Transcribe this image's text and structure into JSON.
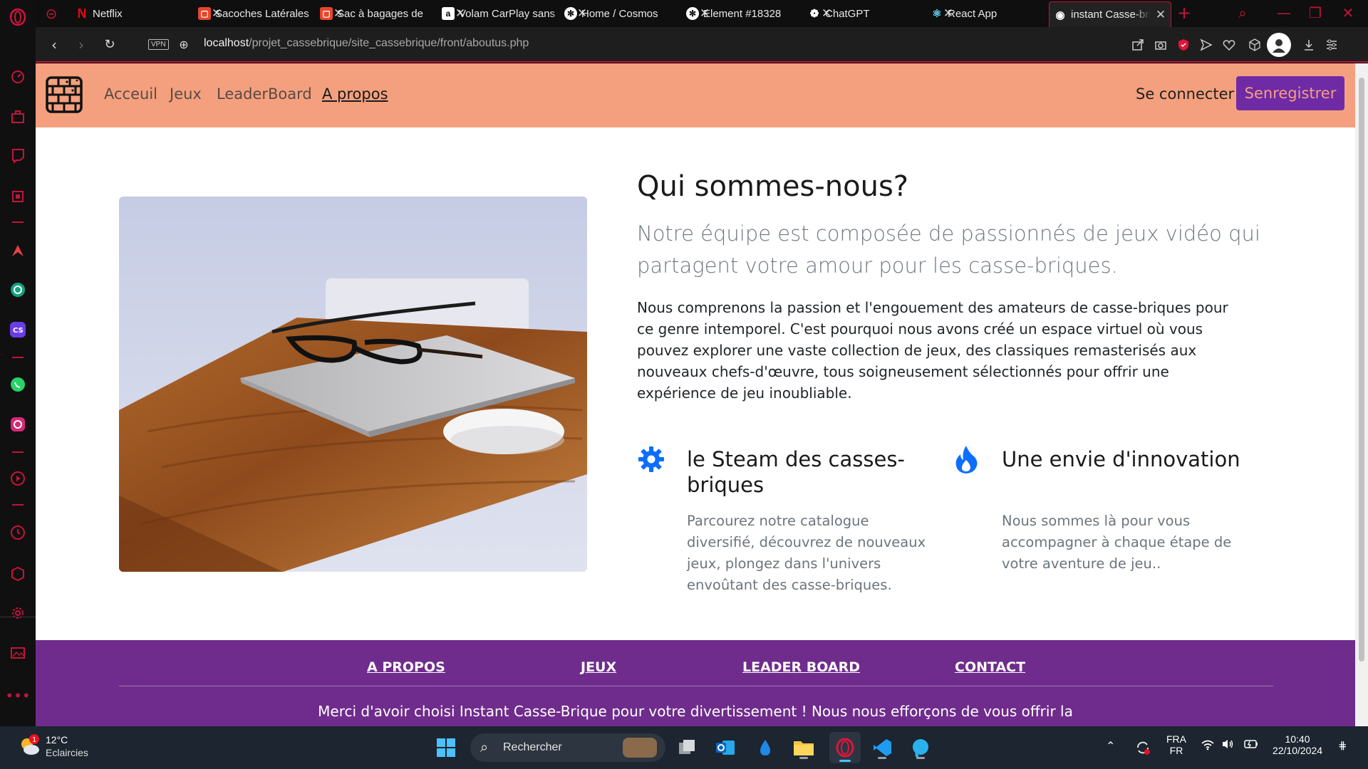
{
  "browser": {
    "tabs": [
      {
        "title": "Netflix",
        "favicon": "netflix-icon",
        "color": "#e50914"
      },
      {
        "title": "Sacoches Latérales",
        "favicon": "shop-icon",
        "color": "#e8462b"
      },
      {
        "title": "Sac à bagages de",
        "favicon": "shop-icon",
        "color": "#e8462b"
      },
      {
        "title": "Volam CarPlay sans",
        "favicon": "amazon-icon",
        "color": "#ffffff"
      },
      {
        "title": "Home / Cosmos",
        "favicon": "cosmos-icon",
        "color": "#ffffff"
      },
      {
        "title": "Element #18328",
        "favicon": "cosmos-icon",
        "color": "#ffffff"
      },
      {
        "title": "ChatGPT",
        "favicon": "chatgpt-icon",
        "color": "#ffffff"
      },
      {
        "title": "React App",
        "favicon": "react-icon",
        "color": "#61dafb"
      },
      {
        "title": "instant Casse-brique",
        "favicon": "globe-icon",
        "color": "#ffffff"
      }
    ],
    "url_host": "localhost",
    "url_path": "/projet_cassebrique/site_cassebrique/front/aboutus.php",
    "vpn_label": "VPN"
  },
  "site": {
    "nav": {
      "links": [
        "Acceuil",
        "Jeux",
        "LeaderBoard",
        "A propos"
      ],
      "login": "Se connecter",
      "register": "Senregistrer"
    },
    "about": {
      "title": "Qui sommes-nous?",
      "lead": "Notre équipe est composée de passionnés de jeux vidéo qui partagent votre amour pour les casse-briques.",
      "body": "Nous comprenons la passion et l'engouement des amateurs de casse-briques pour ce genre intemporel. C'est pourquoi nous avons créé un espace virtuel où vous pouvez explorer une vaste collection de jeux, des classiques remasterisés aux nouveaux chefs-d'œuvre, tous soigneusement sélectionnés pour offrir une expérience de jeu inoubliable."
    },
    "features": [
      {
        "icon": "gear-icon",
        "title": "le Steam des casses-briques",
        "text": "Parcourez notre catalogue diversifié, découvrez de nouveaux jeux, plongez dans l'univers envoûtant des casse-briques."
      },
      {
        "icon": "fire-icon",
        "title": "Une envie d'innovation",
        "text": "Nous sommes là pour vous accompagner à chaque étape de votre aventure de jeu.."
      }
    ],
    "footer": {
      "links": [
        "A PROPOS",
        "JEUX",
        "LEADER BOARD",
        "CONTACT"
      ],
      "text": "Merci d'avoir choisi Instant Casse-Brique pour votre divertissement ! Nous nous efforçons de vous offrir la"
    },
    "colors": {
      "nav_bg": "#f4a07e",
      "accent": "#6f2ba6",
      "footer_bg": "#6f2c8c"
    }
  },
  "taskbar": {
    "weather": {
      "temp": "12°C",
      "condition": "Eclaircies",
      "badge": "1"
    },
    "search_placeholder": "Rechercher",
    "lang_top": "FRA",
    "lang_bottom": "FR",
    "time": "10:40",
    "date": "22/10/2024"
  }
}
